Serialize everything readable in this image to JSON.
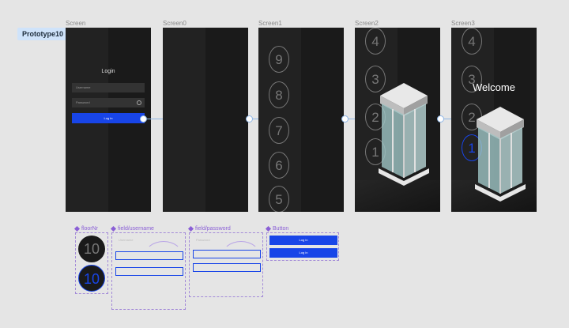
{
  "flow": {
    "label": "Prototype10"
  },
  "screens": [
    {
      "name": "Screen"
    },
    {
      "name": "Screen0"
    },
    {
      "name": "Screen1"
    },
    {
      "name": "Screen2"
    },
    {
      "name": "Screen3"
    }
  ],
  "login": {
    "title": "Login",
    "username_placeholder": "Username",
    "password_placeholder": "Password",
    "button": "Log in"
  },
  "screen1_floors": [
    "9",
    "8",
    "7",
    "6",
    "5"
  ],
  "screen2_floors": [
    "4",
    "3",
    "2",
    "1"
  ],
  "screen3_floors": [
    "4",
    "3",
    "2",
    "1"
  ],
  "welcome": "Welcome",
  "components": {
    "floornr": {
      "label": "floorNr",
      "values": [
        "10",
        "10"
      ]
    },
    "username": {
      "label": "field/username",
      "placeholder": "Username"
    },
    "password": {
      "label": "field/password",
      "placeholder": "Password"
    },
    "button": {
      "label": "Button",
      "text": "Log in"
    }
  },
  "colors": {
    "accent": "#1845e8",
    "component": "#8a5fd6",
    "prototype": "#8fb6e6"
  }
}
